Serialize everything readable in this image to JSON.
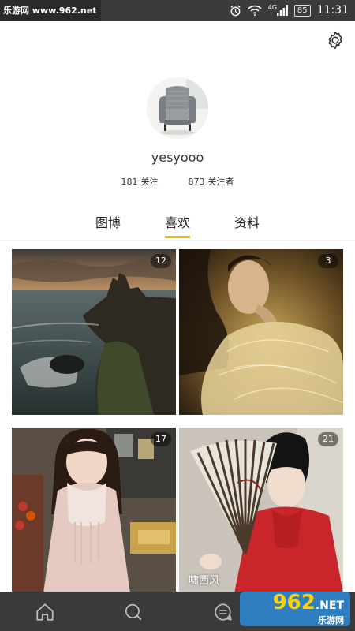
{
  "statusbar": {
    "watermark": "乐游网 www.962.net",
    "network_type": "4G",
    "battery": "85",
    "time": "11:31"
  },
  "header": {
    "settings_icon": "gear-icon",
    "avatar_icon": "armchair-photo",
    "username": "yesyooo",
    "following_count": "181",
    "following_label": "关注",
    "followers_count": "873",
    "followers_label": "关注者"
  },
  "tabs": [
    {
      "label": "图博",
      "active": false
    },
    {
      "label": "喜欢",
      "active": true
    },
    {
      "label": "资料",
      "active": false
    }
  ],
  "grid": [
    {
      "count": "12",
      "caption": ""
    },
    {
      "count": "3",
      "caption": ""
    },
    {
      "count": "17",
      "caption": ""
    },
    {
      "count": "21",
      "caption": "啸西风"
    }
  ],
  "bottom_nav": {
    "items": [
      "home-icon",
      "search-icon",
      "message-icon"
    ]
  },
  "brand": {
    "logo": "962",
    "sub": "乐游网",
    "suffix": ".NET"
  },
  "colors": {
    "accent": "#f1b300",
    "nav_bg": "#3a3a3a",
    "statusbar_bg": "#3b3b3b"
  }
}
